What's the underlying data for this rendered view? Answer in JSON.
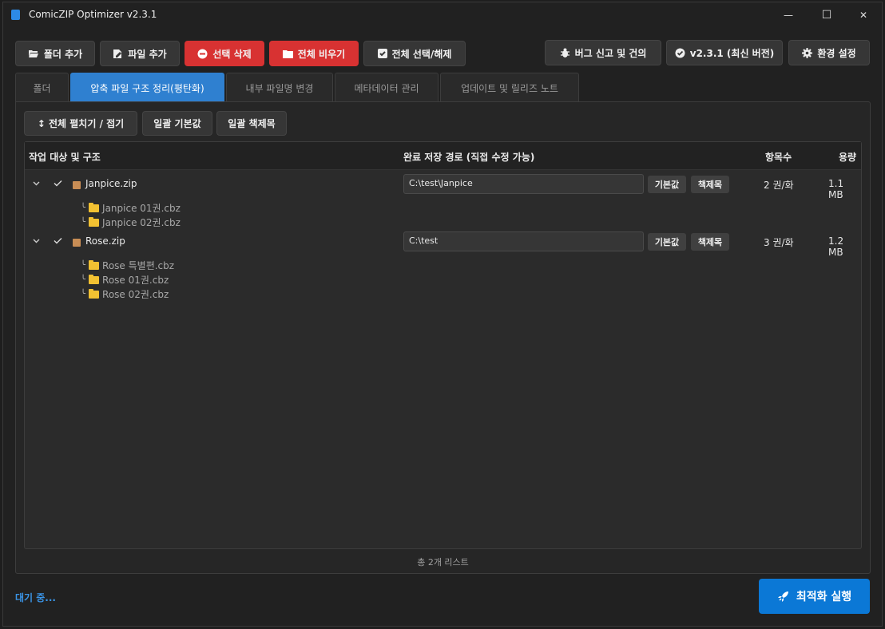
{
  "app": {
    "title": "ComicZIP Optimizer v2.3.1"
  },
  "window_controls": {
    "minimize": "—",
    "maximize": "☐",
    "close": "✕"
  },
  "toolbar": {
    "add_folder": "폴더 추가",
    "add_file": "파일 추가",
    "delete_selected": "선택 삭제",
    "clear_all": "전체 비우기",
    "select_all": "전체 선택/해제",
    "bug_report": "버그 신고 및 건의",
    "version": "v2.3.1 (최신 버전)",
    "settings": "환경 설정"
  },
  "tabs": [
    {
      "label": "폴더"
    },
    {
      "label": "압축 파일 구조 정리(평탄화)"
    },
    {
      "label": "내부 파일명 변경"
    },
    {
      "label": "메타데이터 관리"
    },
    {
      "label": "업데이트 및 릴리즈 노트"
    }
  ],
  "subtoolbar": {
    "expand_collapse": "↕ 전체 펼치기 / 접기",
    "bulk_default": "일괄 기본값",
    "bulk_title": "일괄 책제목"
  },
  "table": {
    "headers": {
      "target": "작업 대상 및 구조",
      "path": "완료 저장 경로 (직접 수정 가능)",
      "count": "항목수",
      "size": "용량"
    },
    "btn_default": "기본값",
    "btn_title": "책제목",
    "items": [
      {
        "name": "Janpice.zip",
        "path": "C:\\test\\Janpice",
        "count": "2 권/화",
        "size": "1.1 MB",
        "children": [
          "Janpice 01권.cbz",
          "Janpice 02권.cbz"
        ]
      },
      {
        "name": "Rose.zip",
        "path": "C:\\test",
        "count": "3 권/화",
        "size": "1.2 MB",
        "children": [
          "Rose 특별편.cbz",
          "Rose 01권.cbz",
          "Rose 02권.cbz"
        ]
      }
    ]
  },
  "footer": {
    "count_text": "총 2개 리스트"
  },
  "status": {
    "text": "대기 중..."
  },
  "run_button": {
    "label": "최적화 실행"
  },
  "colors": {
    "accent": "#2f80d0",
    "danger": "#d83232",
    "run": "#0b78d6",
    "status": "#3a94e6"
  }
}
